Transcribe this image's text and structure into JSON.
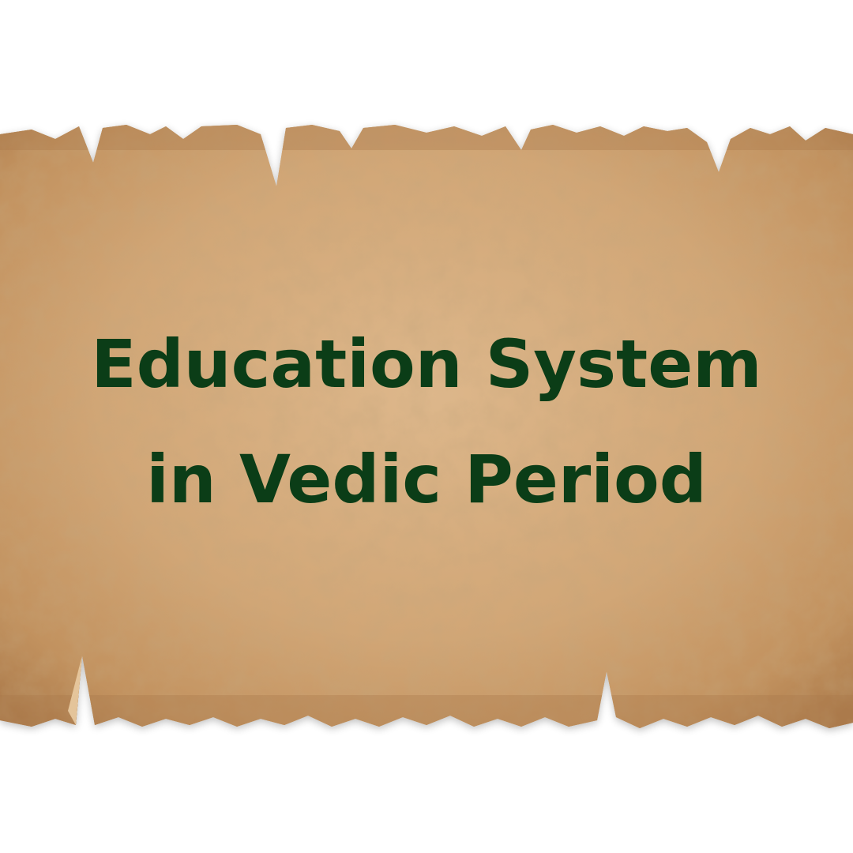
{
  "title": {
    "line1": "Education System",
    "line2": "in Vedic Period"
  },
  "colors": {
    "background": "#ffffff",
    "parchment_light": "#dcb488",
    "parchment_mid": "#c99a68",
    "parchment_edge": "#a8784a",
    "title_text": "#0b3d17"
  }
}
